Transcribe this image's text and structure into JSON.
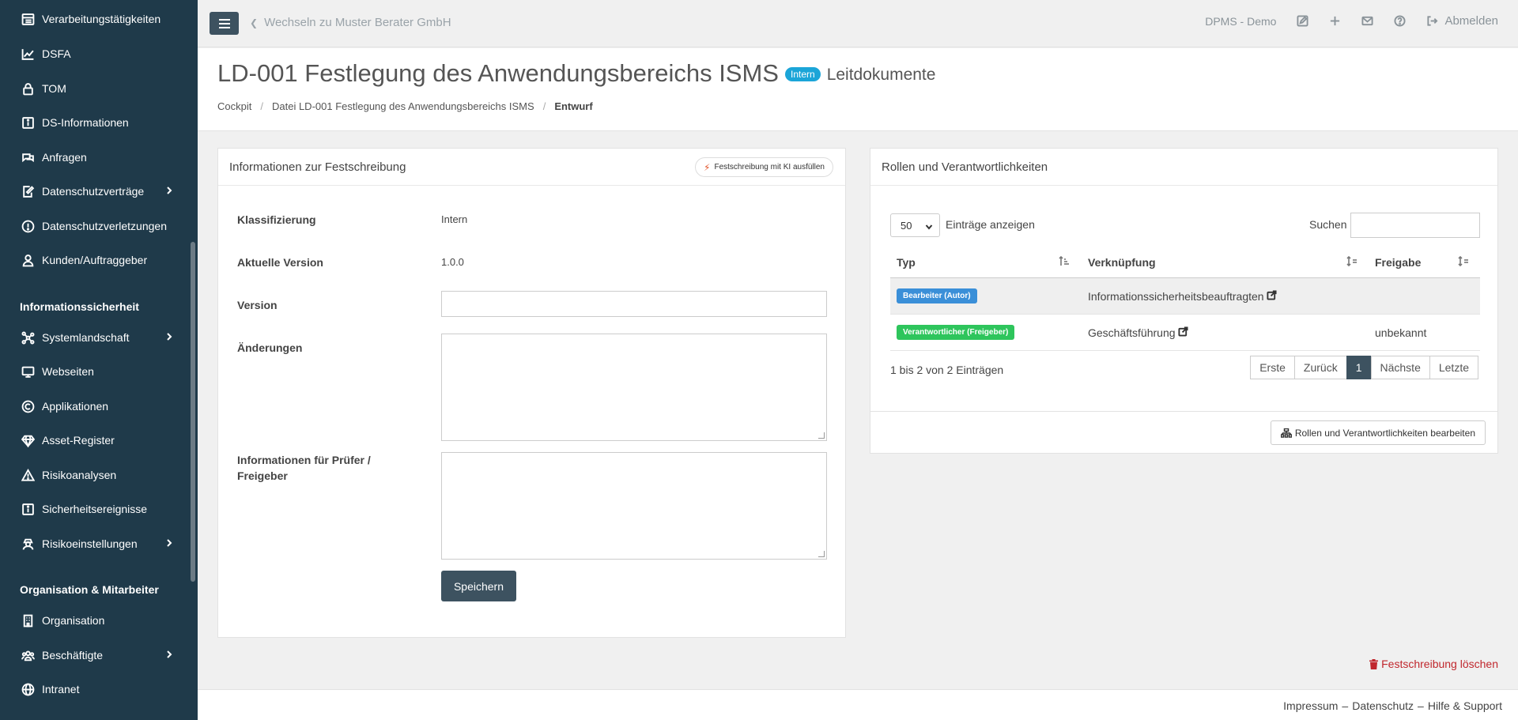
{
  "sidebar": {
    "items": [
      {
        "label": "Verarbeitungstätigkeiten",
        "icon": "table-list-icon"
      },
      {
        "label": "DSFA",
        "icon": "chart-line-icon"
      },
      {
        "label": "TOM",
        "icon": "lock-icon"
      },
      {
        "label": "DS-Informationen",
        "icon": "info-square-icon"
      },
      {
        "label": "Anfragen",
        "icon": "comments-icon"
      },
      {
        "label": "Datenschutzverträge",
        "icon": "file-signature-icon",
        "chevron": true
      },
      {
        "label": "Datenschutzverletzungen",
        "icon": "exclamation-circle-icon"
      },
      {
        "label": "Kunden/Auftraggeber",
        "icon": "user-tie-icon"
      }
    ],
    "section_infosec": "Informationssicherheit",
    "infosec_items": [
      {
        "label": "Systemlandschaft",
        "icon": "network-icon",
        "chevron": true
      },
      {
        "label": "Webseiten",
        "icon": "desktop-icon"
      },
      {
        "label": "Applikationen",
        "icon": "copyright-icon"
      },
      {
        "label": "Asset-Register",
        "icon": "gem-icon"
      },
      {
        "label": "Risikoanalysen",
        "icon": "warning-triangle-icon"
      },
      {
        "label": "Sicherheitsereignisse",
        "icon": "info-square-icon"
      },
      {
        "label": "Risikoeinstellungen",
        "icon": "user-secret-icon",
        "chevron": true
      }
    ],
    "section_org": "Organisation & Mitarbeiter",
    "org_items": [
      {
        "label": "Organisation",
        "icon": "building-icon"
      },
      {
        "label": "Beschäftigte",
        "icon": "users-icon",
        "chevron": true
      },
      {
        "label": "Intranet",
        "icon": "globe-icon"
      }
    ]
  },
  "topbar": {
    "switch_label": "Wechseln zu Muster Berater GmbH",
    "tenant": "DPMS - Demo",
    "logout_label": "Abmelden"
  },
  "header": {
    "title": "LD-001 Festlegung des Anwendungsbereichs ISMS",
    "badge": "Intern",
    "subtitle": "Leitdokumente",
    "breadcrumb": [
      "Cockpit",
      "Datei LD-001 Festlegung des Anwendungsbereichs ISMS",
      "Entwurf"
    ]
  },
  "left_panel": {
    "title": "Informationen zur Festschreibung",
    "ki_button": "Festschreibung mit KI ausfüllen",
    "classification_label": "Klassifizierung",
    "classification_value": "Intern",
    "current_version_label": "Aktuelle Version",
    "current_version_value": "1.0.0",
    "version_label": "Version",
    "version_value": "",
    "changes_label": "Änderungen",
    "changes_value": "",
    "reviewer_info_label": "Informationen für Prüfer / Freigeber",
    "reviewer_info_value": "",
    "save_button": "Speichern"
  },
  "right_panel": {
    "title": "Rollen und Verantwortlichkeiten",
    "length_value": "50",
    "length_label": "Einträge anzeigen",
    "search_label": "Suchen",
    "search_value": "",
    "columns": [
      "Typ",
      "Verknüpfung",
      "Freigabe"
    ],
    "rows": [
      {
        "type": "Bearbeiter (Autor)",
        "type_color": "#3a8fd8",
        "link": "Informationssicherheitsbeauftragten",
        "approval": ""
      },
      {
        "type": "Verantwortlicher (Freigeber)",
        "type_color": "#2ec55c",
        "link": "Geschäftsführung",
        "approval": "unbekannt"
      }
    ],
    "info": "1 bis 2 von 2 Einträgen",
    "pagination": [
      "Erste",
      "Zurück",
      "1",
      "Nächste",
      "Letzte"
    ],
    "current_page": "1",
    "edit_button": "Rollen und Verantwortlichkeiten bearbeiten"
  },
  "delete_label": "Festschreibung löschen",
  "footer": {
    "impressum": "Impressum",
    "datenschutz": "Datenschutz",
    "support": "Hilfe & Support"
  }
}
